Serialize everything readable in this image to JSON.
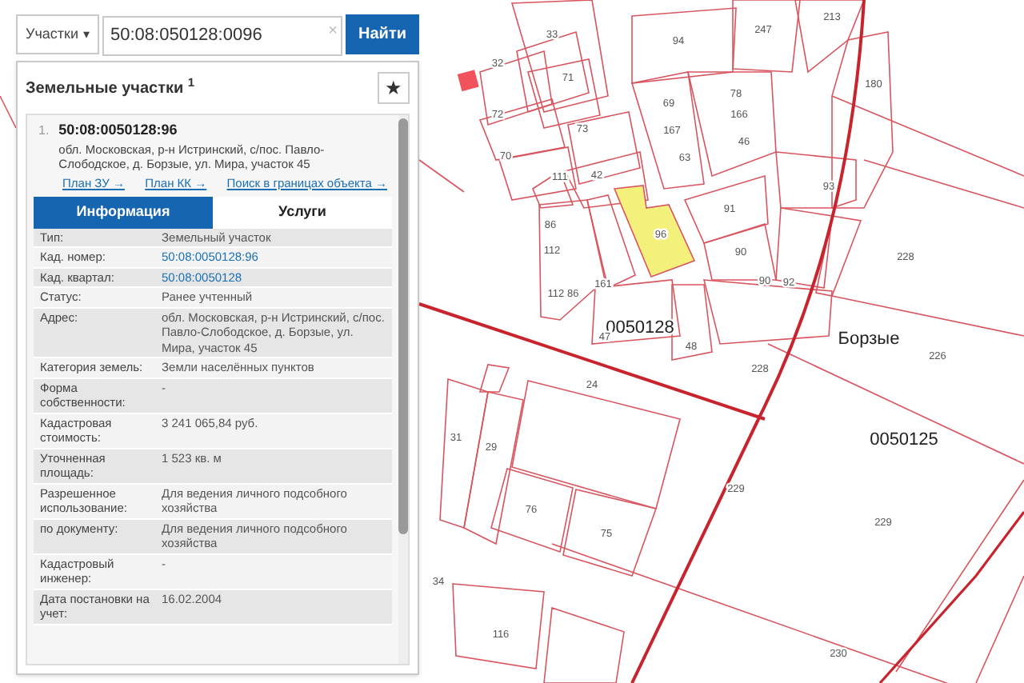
{
  "search": {
    "type_dropdown": "Участки",
    "caret": "▾",
    "value": "50:08:050128:0096",
    "clear": "×",
    "button": "Найти"
  },
  "results_panel": {
    "title": "Земельные участки $^{1}$",
    "star": "★",
    "result": {
      "number": "1.",
      "cadastral_number": "50:08:0050128:96",
      "address": "обл. Московская, р-н Истринский, с/пос. Павло-Слободское, д. Борзые, ул. Мира, участок 45",
      "links": [
        "План ЗУ →",
        "План КК →",
        "Поиск в границах объекта →"
      ],
      "tabs": [
        {
          "label": "Информация",
          "selected": true
        },
        {
          "label": "Услуги",
          "selected": false
        }
      ],
      "fields": [
        {
          "label": "Тип:",
          "value": "Земельный участок",
          "kind": "text"
        },
        {
          "label": "Кад. номер:",
          "value": "50:08:0050128:96",
          "kind": "link"
        },
        {
          "label": "Кад. квартал:",
          "value": "50:08:0050128",
          "kind": "link"
        },
        {
          "label": "Статус:",
          "value": "Ранее учтенный",
          "kind": "text"
        },
        {
          "label": "Адрес:",
          "value": "обл. Московская, р-н Истринский, с/пос. Павло-Слободское, д. Борзые, ул. Мира, участок 45",
          "kind": "text"
        },
        {
          "label": "Категория земель:",
          "value": "Земли населённых пунктов",
          "kind": "text"
        },
        {
          "label": "Форма собственности:",
          "value": "-",
          "kind": "text"
        },
        {
          "label": "Кадастровая стоимость:",
          "value": "3 241 065,84 руб.",
          "kind": "text"
        },
        {
          "label": "Уточненная площадь:",
          "value": "1 523 кв. м",
          "kind": "text"
        },
        {
          "label": "Разрешенное использование:",
          "value": "Для ведения личного подсобного хозяйства",
          "kind": "text"
        },
        {
          "label": "по документу:",
          "value": "Для ведения личного подсобного хозяйства",
          "kind": "text"
        },
        {
          "label": "Кадастровый инженер:",
          "value": "-",
          "kind": "text"
        },
        {
          "label": "Дата постановки на учет:",
          "value": "16.02.2004",
          "kind": "text"
        }
      ]
    }
  },
  "map": {
    "labels": [
      {
        "text": "33",
        "kind": "parcel"
      },
      {
        "text": "94",
        "kind": "parcel"
      },
      {
        "text": "247",
        "kind": "parcel"
      },
      {
        "text": "213",
        "kind": "parcel"
      },
      {
        "text": "32",
        "kind": "parcel"
      },
      {
        "text": "180",
        "kind": "parcel"
      },
      {
        "text": "71",
        "kind": "parcel"
      },
      {
        "text": "69",
        "kind": "parcel"
      },
      {
        "text": "78",
        "kind": "parcel"
      },
      {
        "text": "166",
        "kind": "parcel"
      },
      {
        "text": "72",
        "kind": "parcel"
      },
      {
        "text": "73",
        "kind": "parcel"
      },
      {
        "text": "167",
        "kind": "parcel"
      },
      {
        "text": "46",
        "kind": "parcel"
      },
      {
        "text": "70",
        "kind": "parcel"
      },
      {
        "text": "63",
        "kind": "parcel"
      },
      {
        "text": "42",
        "kind": "parcel"
      },
      {
        "text": "111",
        "kind": "parcel"
      },
      {
        "text": "91",
        "kind": "parcel"
      },
      {
        "text": "93",
        "kind": "parcel"
      },
      {
        "text": "96",
        "kind": "parcel"
      },
      {
        "text": "86",
        "kind": "parcel"
      },
      {
        "text": "112",
        "kind": "parcel"
      },
      {
        "text": "90",
        "kind": "parcel"
      },
      {
        "text": "228",
        "kind": "parcel"
      },
      {
        "text": "112 86",
        "kind": "parcel"
      },
      {
        "text": "161",
        "kind": "parcel"
      },
      {
        "text": "90",
        "kind": "parcel"
      },
      {
        "text": "92",
        "kind": "parcel"
      },
      {
        "text": "0050128",
        "kind": "quarter"
      },
      {
        "text": "47",
        "kind": "parcel"
      },
      {
        "text": "48",
        "kind": "parcel"
      },
      {
        "text": "Борзые",
        "kind": "place"
      },
      {
        "text": "228",
        "kind": "parcel"
      },
      {
        "text": "226",
        "kind": "parcel"
      },
      {
        "text": "24",
        "kind": "parcel"
      },
      {
        "text": "31",
        "kind": "parcel"
      },
      {
        "text": "29",
        "kind": "parcel"
      },
      {
        "text": "0050125",
        "kind": "quarter"
      },
      {
        "text": "229",
        "kind": "parcel"
      },
      {
        "text": "229",
        "kind": "parcel"
      },
      {
        "text": "76",
        "kind": "parcel"
      },
      {
        "text": "75",
        "kind": "parcel"
      },
      {
        "text": "34",
        "kind": "parcel"
      },
      {
        "text": "116",
        "kind": "parcel"
      },
      {
        "text": "230",
        "kind": "parcel"
      }
    ]
  }
}
